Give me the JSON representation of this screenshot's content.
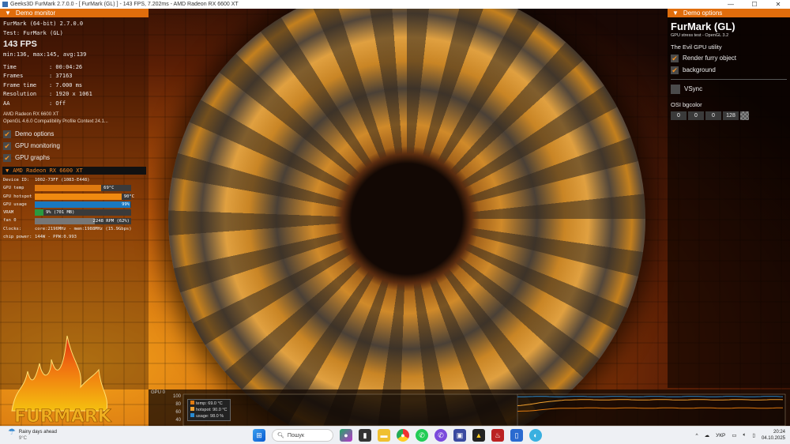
{
  "window": {
    "title": "Geeks3D FurMark 2.7.0.0 - [ FurMark (GL) ] - 143 FPS, 7.202ms - AMD Radeon RX 6600 XT",
    "minimize": "—",
    "maximize": "☐",
    "close": "✕"
  },
  "monitor": {
    "header": "Demo monitor",
    "app": "FurMark (64-bit) 2.7.0.0",
    "test": "Test: FurMark (GL)",
    "fps": "143 FPS",
    "fps_stats": "min:136, max:145, avg:139",
    "stats": [
      {
        "k": "Time",
        "v": ": 00:04:26"
      },
      {
        "k": "Frames",
        "v": ": 37163"
      },
      {
        "k": "Frame time",
        "v": ": 7.000 ms"
      },
      {
        "k": "Resolution",
        "v": ": 1920 x 1061"
      },
      {
        "k": "AA",
        "v": ": Off"
      }
    ],
    "gpu_name": "AMD Radeon RX 6600 XT",
    "opengl": "OpenGL 4.6.0 Compatibility Profile Context 24.1...",
    "checks": [
      "Demo options",
      "GPU monitoring",
      "GPU graphs"
    ]
  },
  "gpu": {
    "header": "AMD Radeon RX 6600 XT",
    "device_id_label": "Device ID:",
    "device_id": "1002-73FF (1083-E448)",
    "temp_label": "GPU temp",
    "temp": "69°C",
    "temp_pct": 69,
    "hotspot_label": "GPU hotspot",
    "hotspot": "90°C",
    "hotspot_pct": 90,
    "usage_label": "GPU usage",
    "usage": "99%",
    "usage_pct": 99,
    "vram_label": "VRAM",
    "vram": "9% (701 MB)",
    "vram_pct": 9,
    "fan_label": "fan 0",
    "fan": "2248 RPM (62%)",
    "fan_pct": 62,
    "clocks_label": "Clocks:",
    "clocks": "core:2196MHz - mem:1988MHz (15.9Gbps)",
    "power_label": "chip power:",
    "power": "144W - PPW:0.993"
  },
  "options": {
    "header": "Demo options",
    "title": "FurMark (GL)",
    "subtitle": "GPU stress test - OpenGL 3.2",
    "utility": "The Evil GPU utility",
    "render_furry": "Render furry object",
    "background": "background",
    "vsync": "VSync",
    "osi_label": "OSI bgcolor",
    "osi": [
      "0",
      "0",
      "0",
      "128"
    ]
  },
  "graph": {
    "label": "GPU 0",
    "yticks": [
      "100",
      "80",
      "60",
      "40"
    ],
    "legend": [
      {
        "text": "temp: 69.0 °C",
        "color": "#e07a10"
      },
      {
        "text": "hotspot: 90.0 °C",
        "color": "#f0a030"
      },
      {
        "text": "usage: 98.0 %",
        "color": "#2a8ad0"
      }
    ]
  },
  "taskbar": {
    "weather_title": "Rainy days ahead",
    "weather_temp": "9°C",
    "search": "Пошук",
    "lang": "УКР",
    "time": "20:24",
    "date": "04.10.2025"
  }
}
